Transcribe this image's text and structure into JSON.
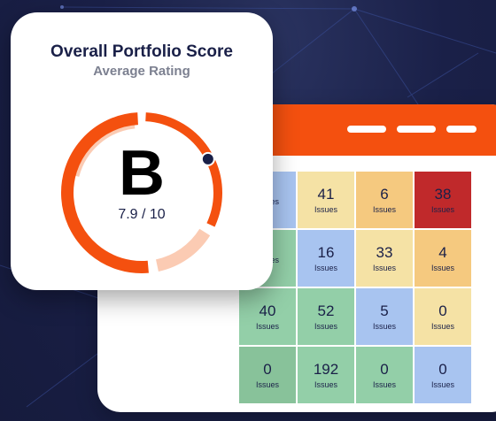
{
  "score_card": {
    "title": "Overall Portfolio Score",
    "subtitle": "Average Rating",
    "grade": "B",
    "score_text": "7.9 / 10",
    "score_fraction": 0.79,
    "colors": {
      "accent": "#f4500f",
      "track": "#fbcbb3",
      "marker": "#1a2048"
    }
  },
  "panel": {
    "header_color": "#f4500f"
  },
  "heatmap": {
    "rows": [
      [
        {
          "value": "",
          "label": "Issues",
          "color": "#a8c4f0"
        },
        {
          "value": "41",
          "label": "Issues",
          "color": "#f5e2a5"
        },
        {
          "value": "6",
          "label": "Issues",
          "color": "#f5c97f"
        },
        {
          "value": "38",
          "label": "Issues",
          "color": "#c0292b"
        }
      ],
      [
        {
          "value": "",
          "label": "Issues",
          "color": "#93cfa8"
        },
        {
          "value": "16",
          "label": "Issues",
          "color": "#a8c4f0"
        },
        {
          "value": "33",
          "label": "Issues",
          "color": "#f5e2a5"
        },
        {
          "value": "4",
          "label": "Issues",
          "color": "#f5c97f"
        }
      ],
      [
        {
          "value": "40",
          "label": "Issues",
          "color": "#93cfa8"
        },
        {
          "value": "52",
          "label": "Issues",
          "color": "#93cfa8"
        },
        {
          "value": "5",
          "label": "Issues",
          "color": "#a8c4f0"
        },
        {
          "value": "0",
          "label": "Issues",
          "color": "#f5e2a5"
        }
      ],
      [
        {
          "value": "0",
          "label": "Issues",
          "color": "#88c29a"
        },
        {
          "value": "192",
          "label": "Issues",
          "color": "#93cfa8"
        },
        {
          "value": "0",
          "label": "Issues",
          "color": "#93cfa8"
        },
        {
          "value": "0",
          "label": "Issues",
          "color": "#a8c4f0"
        }
      ]
    ]
  }
}
